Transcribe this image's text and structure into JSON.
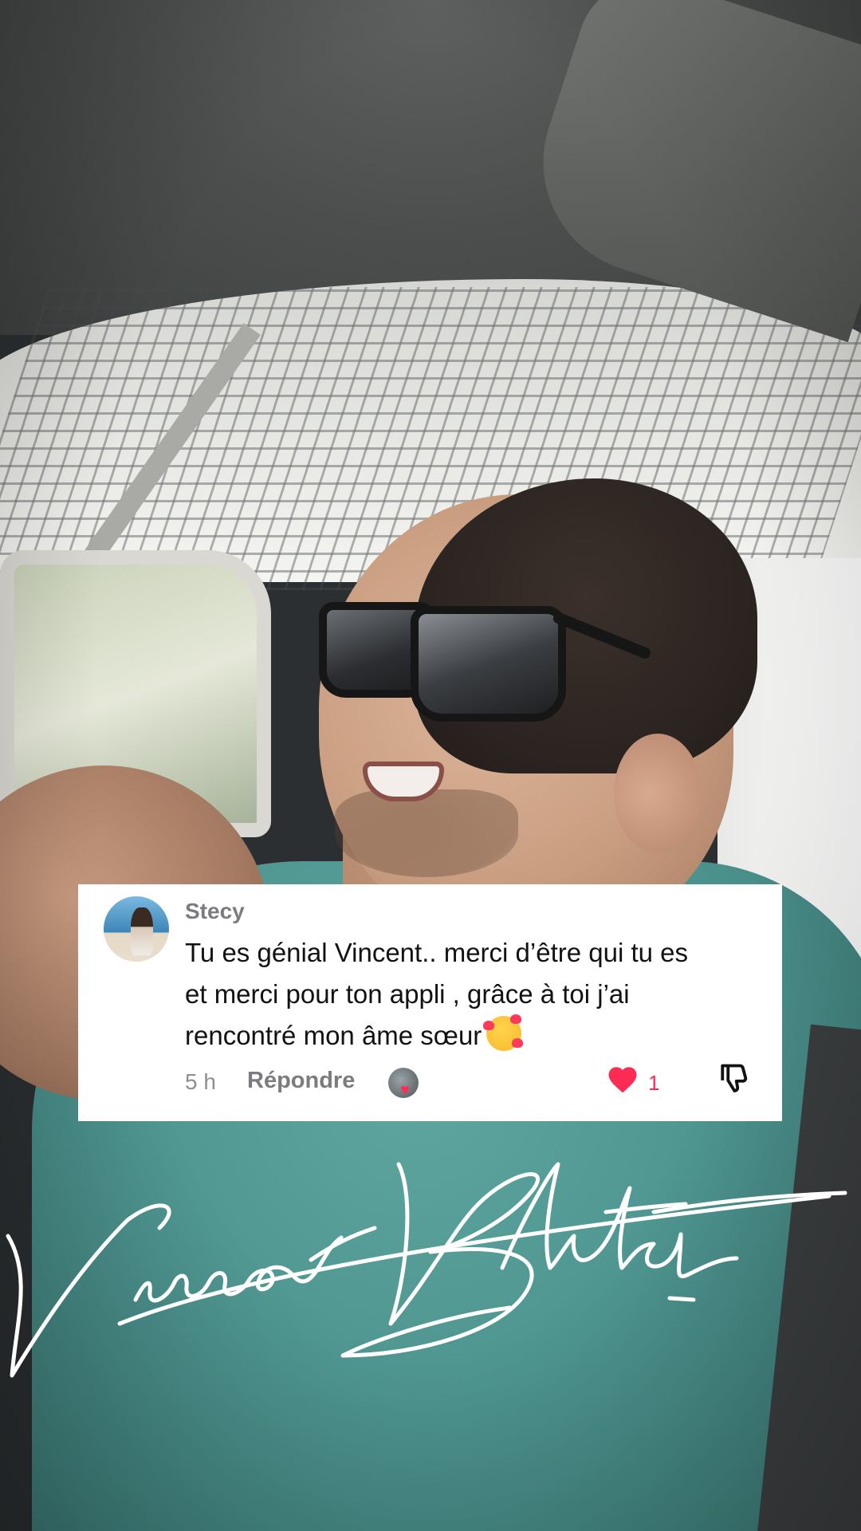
{
  "comment": {
    "username": "Stecy",
    "text_line1": "Tu es génial Vincent.. merci d’être qui tu es",
    "text_line2": "et merci pour ton appli , grâce à toi j’ai",
    "text_line3": "rencontré mon âme sœur",
    "emoji": "smiling-face-with-hearts",
    "time": "5 h",
    "reply_label": "Répondre",
    "likes": "1",
    "creator_liked": true
  },
  "watermark": {
    "signature": "Vincent Blitch"
  },
  "colors": {
    "like_red": "#fe2c55",
    "username_gray": "#7b7b80",
    "text_dark": "#111214",
    "card_bg": "#ffffff"
  },
  "icons": {
    "like": "heart-filled-icon",
    "dislike": "thumbs-down-icon",
    "creator_like": "creator-heart-icon"
  }
}
